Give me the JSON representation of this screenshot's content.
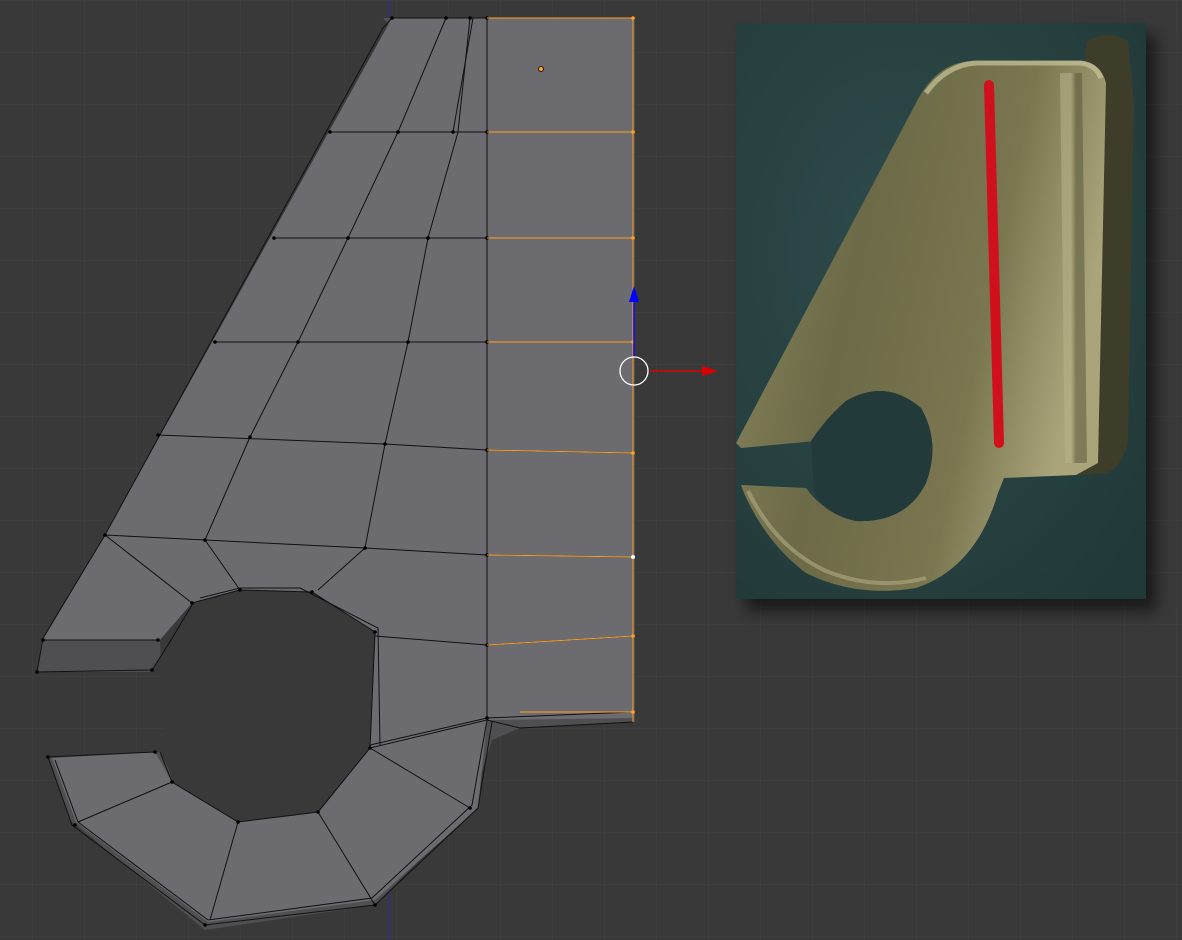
{
  "viewport": {
    "background_color": "#393939",
    "grid_color": "#434343",
    "face_color": "#6b6b70",
    "edge_color": "#111111",
    "selected_edge_color": "#ffa020",
    "x_axis_color": "#dd0000",
    "z_axis_color": "#0000ff",
    "y_axis_color": "#2a2aa8"
  },
  "reference_image": {
    "background_color": "#2a4545",
    "part_color": "#7c7a55",
    "marker_color": "#d0101c"
  }
}
